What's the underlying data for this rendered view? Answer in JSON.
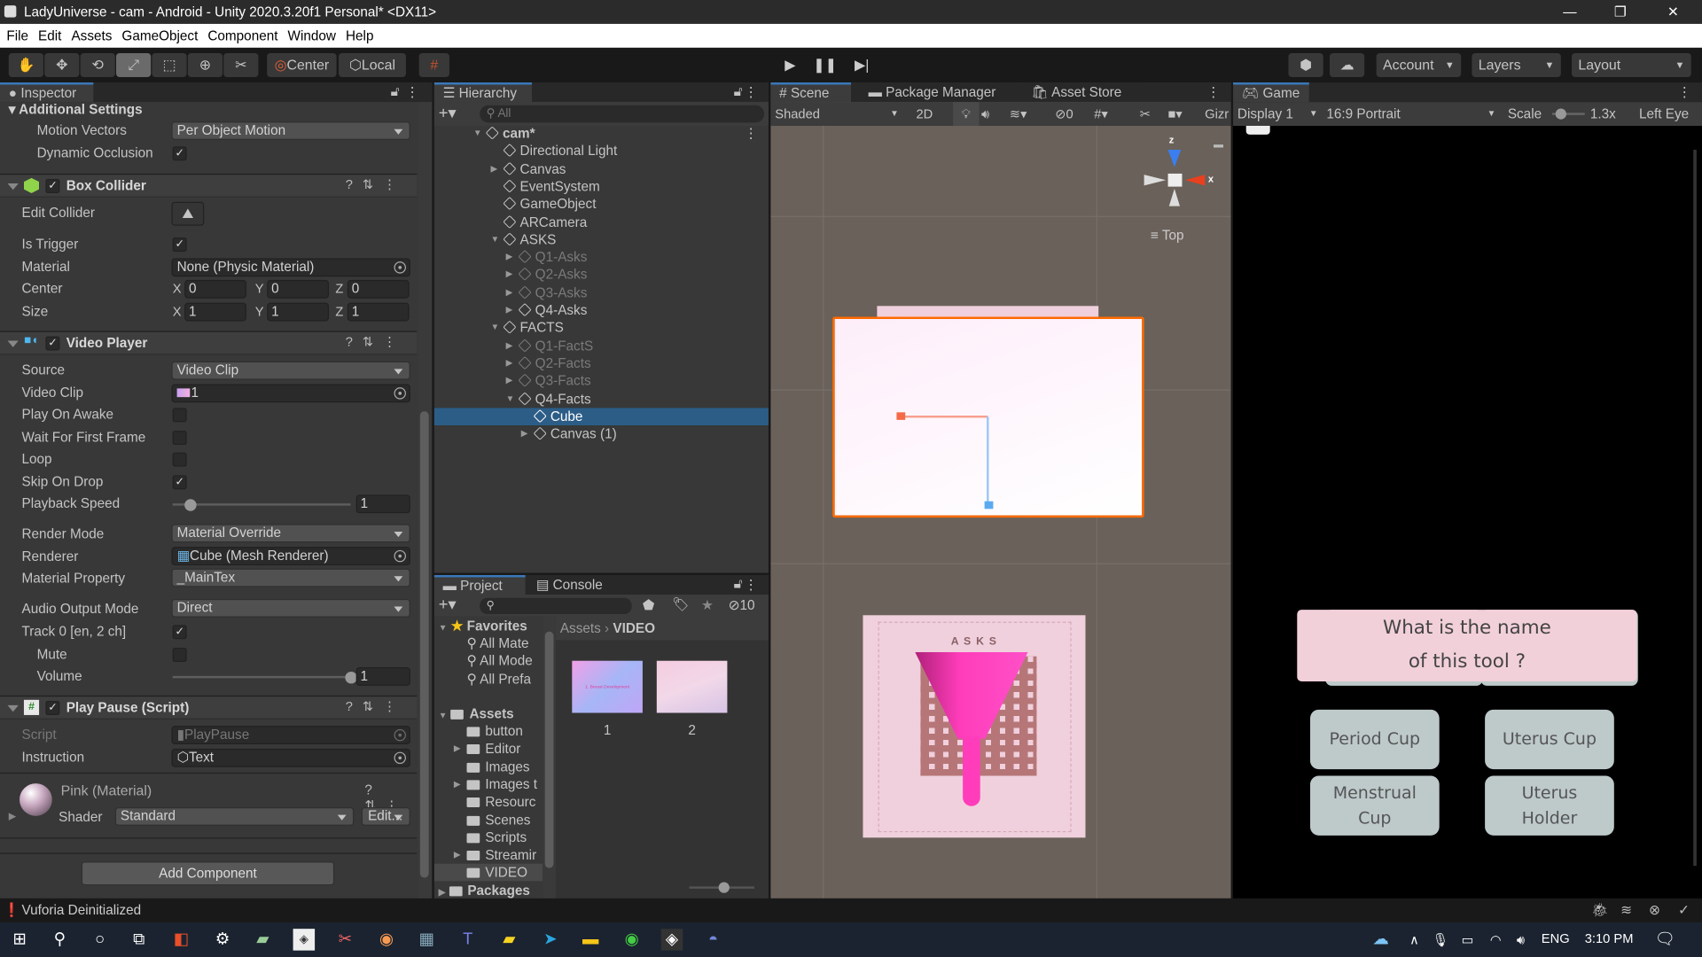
{
  "window": {
    "title": "LadyUniverse - cam - Android - Unity 2020.3.20f1 Personal* <DX11>",
    "minimize": "—",
    "restore": "❐",
    "close": "✕"
  },
  "menu": [
    "File",
    "Edit",
    "Assets",
    "GameObject",
    "Component",
    "Window",
    "Help"
  ],
  "toolbar": {
    "pivot": "Center",
    "space": "Local",
    "account": "Account",
    "layers": "Layers",
    "layout": "Layout",
    "tools": [
      "hand-tool",
      "move-tool",
      "rotate-tool",
      "scale-tool",
      "rect-tool",
      "transform-tool",
      "custom-tool"
    ],
    "active_tool": "scale-tool"
  },
  "inspector": {
    "tab": "Inspector",
    "additional_settings": {
      "title": "Additional Settings",
      "motion_vectors_label": "Motion Vectors",
      "motion_vectors": "Per Object Motion",
      "dynamic_occlusion_label": "Dynamic Occlusion",
      "dynamic_occlusion": true
    },
    "box_collider": {
      "title": "Box Collider",
      "enabled": true,
      "edit_collider": "Edit Collider",
      "is_trigger_label": "Is Trigger",
      "is_trigger": true,
      "material_label": "Material",
      "material": "None (Physic Material)",
      "center_label": "Center",
      "center": {
        "x": "0",
        "y": "0",
        "z": "0"
      },
      "size_label": "Size",
      "size": {
        "x": "1",
        "y": "1",
        "z": "1"
      }
    },
    "video_player": {
      "title": "Video Player",
      "enabled": true,
      "source_label": "Source",
      "source": "Video Clip",
      "video_clip_label": "Video Clip",
      "video_clip": "1",
      "play_on_awake_label": "Play On Awake",
      "play_on_awake": false,
      "wait_label": "Wait For First Frame",
      "wait_for_first_frame": false,
      "loop_label": "Loop",
      "loop": false,
      "skip_label": "Skip On Drop",
      "skip_on_drop": true,
      "playback_speed_label": "Playback Speed",
      "playback_speed": "1",
      "playback_speed_fraction": 0.1,
      "render_mode_label": "Render Mode",
      "render_mode": "Material Override",
      "renderer_label": "Renderer",
      "renderer": "Cube (Mesh Renderer)",
      "material_property_label": "Material Property",
      "material_property": "_MainTex",
      "audio_output_label": "Audio Output Mode",
      "audio_output_mode": "Direct",
      "track_label": "Track 0 [en, 2 ch]",
      "track_enabled": true,
      "mute_label": "Mute",
      "mute": false,
      "volume_label": "Volume",
      "volume": "1",
      "volume_fraction": 1.0
    },
    "play_pause": {
      "title": "Play Pause (Script)",
      "enabled": true,
      "script_label": "Script",
      "script": "PlayPause",
      "instruction_label": "Instruction",
      "instruction": "Text"
    },
    "material": {
      "title": "Pink (Material)",
      "shader_label": "Shader",
      "shader": "Standard",
      "edit": "Edit..."
    },
    "add_component": "Add Component"
  },
  "hierarchy": {
    "tab": "Hierarchy",
    "search_placeholder": "All",
    "items": [
      {
        "label": "cam*",
        "depth": 0,
        "expanded": true,
        "bold": true
      },
      {
        "label": "Directional Light",
        "depth": 1
      },
      {
        "label": "Canvas",
        "depth": 1,
        "expandable": true
      },
      {
        "label": "EventSystem",
        "depth": 1
      },
      {
        "label": "GameObject",
        "depth": 1
      },
      {
        "label": "ARCamera",
        "depth": 1
      },
      {
        "label": "ASKS",
        "depth": 1,
        "expanded": true
      },
      {
        "label": "Q1-Asks",
        "depth": 2,
        "expandable": true,
        "dim": true
      },
      {
        "label": "Q2-Asks",
        "depth": 2,
        "expandable": true,
        "dim": true
      },
      {
        "label": "Q3-Asks",
        "depth": 2,
        "expandable": true,
        "dim": true
      },
      {
        "label": "Q4-Asks",
        "depth": 2,
        "expandable": true
      },
      {
        "label": "FACTS",
        "depth": 1,
        "expanded": true
      },
      {
        "label": "Q1-FactS",
        "depth": 2,
        "expandable": true,
        "dim": true
      },
      {
        "label": "Q2-Facts",
        "depth": 2,
        "expandable": true,
        "dim": true
      },
      {
        "label": "Q3-Facts",
        "depth": 2,
        "expandable": true,
        "dim": true
      },
      {
        "label": "Q4-Facts",
        "depth": 2,
        "expanded": true
      },
      {
        "label": "Cube",
        "depth": 3,
        "selected": true
      },
      {
        "label": "Canvas (1)",
        "depth": 3,
        "expandable": true
      }
    ]
  },
  "project": {
    "tabs": [
      "Project",
      "Console"
    ],
    "hidden_count": "10",
    "favorites": {
      "title": "Favorites",
      "items": [
        "All Mate",
        "All Mode",
        "All Prefa"
      ]
    },
    "assets": {
      "title": "Assets",
      "items": [
        {
          "label": "button"
        },
        {
          "label": "Editor",
          "expandable": true
        },
        {
          "label": "Images"
        },
        {
          "label": "Images t",
          "expandable": true
        },
        {
          "label": "Resourc"
        },
        {
          "label": "Scenes"
        },
        {
          "label": "Scripts"
        },
        {
          "label": "Streamir",
          "expandable": true
        },
        {
          "label": "VIDEO",
          "selected": true
        }
      ]
    },
    "packages": "Packages",
    "breadcrumb": [
      "Assets",
      "VIDEO"
    ],
    "files": [
      {
        "name": "1",
        "thumb_text": "1. Breast Development"
      },
      {
        "name": "2"
      }
    ]
  },
  "scene": {
    "tabs": [
      "Scene",
      "Package Manager",
      "Asset Store"
    ],
    "shading": "Shaded",
    "mode_2d": "2D",
    "hidden_count": "0",
    "gizmos": "Gizr",
    "view_label": "Top",
    "axis_x": "x",
    "axis_z": "z",
    "card_label": "A S K S"
  },
  "game": {
    "tab": "Game",
    "display": "Display 1",
    "aspect": "16:9 Portrait",
    "scale_label": "Scale",
    "scale": "1.3x",
    "eye": "Left Eye",
    "question": "What is the name of this tool ?",
    "answers": [
      "Period Cup",
      "Uterus Cup",
      "Menstrual Cup",
      "Uterus Holder"
    ]
  },
  "status": {
    "message": "Vuforia Deinitialized"
  },
  "taskbar": {
    "language": "ENG",
    "time": "3:10 PM"
  },
  "colors": {
    "selection": "#2c5d87",
    "accent_tab": "#3a79bb",
    "scene_bg": "#6a615a",
    "selection_outline": "#ff6a00",
    "question_bg": "#f2d0d9",
    "answer_bg": "#bec9ca",
    "cup": "#ff3dbb"
  }
}
